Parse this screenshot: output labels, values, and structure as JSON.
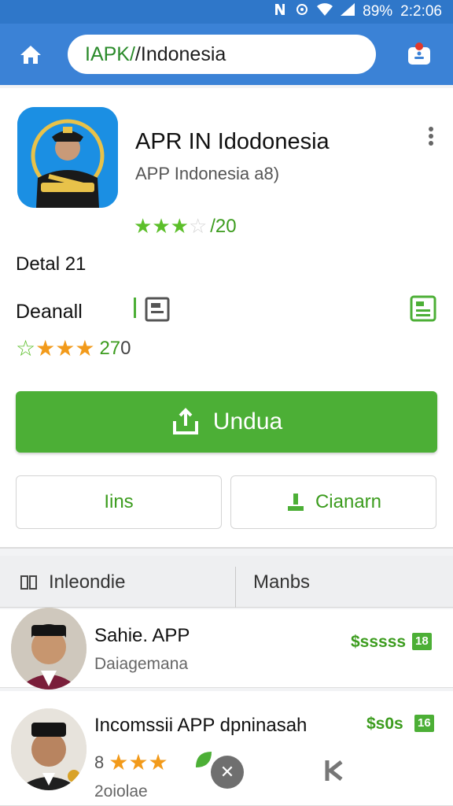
{
  "status_bar": {
    "battery": "89%",
    "time": "2:2:06"
  },
  "browser": {
    "url_prefix": "IAPK/",
    "url_rest": "/Indonesia"
  },
  "app": {
    "title": "APR IN Idodonesia",
    "subtitle": "APP Indonesia  a8)",
    "rating_text": "/20",
    "rating_stars": 3,
    "detail_label": "Detal 21",
    "download_label": "Deanall",
    "rating2_text_green": "27",
    "rating2_text_gray": "0",
    "rating2_stars": 3
  },
  "buttons": {
    "primary": "Undua",
    "left": "Iins",
    "right": "Cianarn"
  },
  "tabs": [
    {
      "label": "Inleondie"
    },
    {
      "label": "Manbs"
    }
  ],
  "list": [
    {
      "name": "Sahie. APP",
      "sub": "Daiagemana",
      "price": "$sssss",
      "badge": "18"
    },
    {
      "name": "Incomssii APP dpninasah",
      "sub": "2oiolae",
      "price": "$s0s",
      "badge": "16",
      "lead": "8",
      "stars": 3
    }
  ],
  "colors": {
    "status_bar": "#2f77c9",
    "app_bar": "#3b82d6",
    "accent_green": "#4caf36",
    "star_orange": "#f29a1a"
  }
}
